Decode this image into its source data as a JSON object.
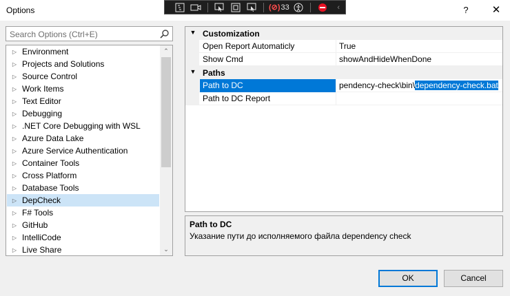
{
  "window": {
    "title": "Options",
    "help": "?",
    "close": "✕"
  },
  "toolbar": {
    "count": "33",
    "icons": [
      "live-visual-tree-icon",
      "record-icon",
      "select-element-icon",
      "display-adorners-icon",
      "track-focus-icon",
      "binding-failures-icon",
      "accessibility-icon",
      "hot-reload-stop-icon",
      "collapse-icon"
    ]
  },
  "search": {
    "placeholder": "Search Options (Ctrl+E)"
  },
  "tree": {
    "items": [
      {
        "label": "Environment"
      },
      {
        "label": "Projects and Solutions"
      },
      {
        "label": "Source Control"
      },
      {
        "label": "Work Items"
      },
      {
        "label": "Text Editor"
      },
      {
        "label": "Debugging"
      },
      {
        "label": ".NET Core Debugging with WSL"
      },
      {
        "label": "Azure Data Lake"
      },
      {
        "label": "Azure Service Authentication"
      },
      {
        "label": "Container Tools"
      },
      {
        "label": "Cross Platform"
      },
      {
        "label": "Database Tools"
      },
      {
        "label": "DepCheck"
      },
      {
        "label": "F# Tools"
      },
      {
        "label": "GitHub"
      },
      {
        "label": "IntelliCode"
      },
      {
        "label": "Live Share"
      }
    ],
    "selected": "DepCheck"
  },
  "grid": {
    "categories": [
      {
        "name": "Customization",
        "properties": [
          {
            "name": "Open Report Automaticly",
            "value": "True"
          },
          {
            "name": "Show Cmd",
            "value": "showAndHideWhenDone"
          }
        ]
      },
      {
        "name": "Paths",
        "properties": [
          {
            "name": "Path to DC",
            "value_prefix": "pendency-check\\bin\\",
            "value_selected": "dependency-check.bat"
          },
          {
            "name": "Path to DC Report",
            "value": ""
          }
        ]
      }
    ]
  },
  "description": {
    "title": "Path to DC",
    "text": "Указание пути до исполняемого файла dependency check"
  },
  "buttons": {
    "ok": "OK",
    "cancel": "Cancel"
  },
  "colors": {
    "selection": "#0078d7",
    "tree_selection": "#cce4f7",
    "toolbar_bg": "#1e1e1e"
  }
}
